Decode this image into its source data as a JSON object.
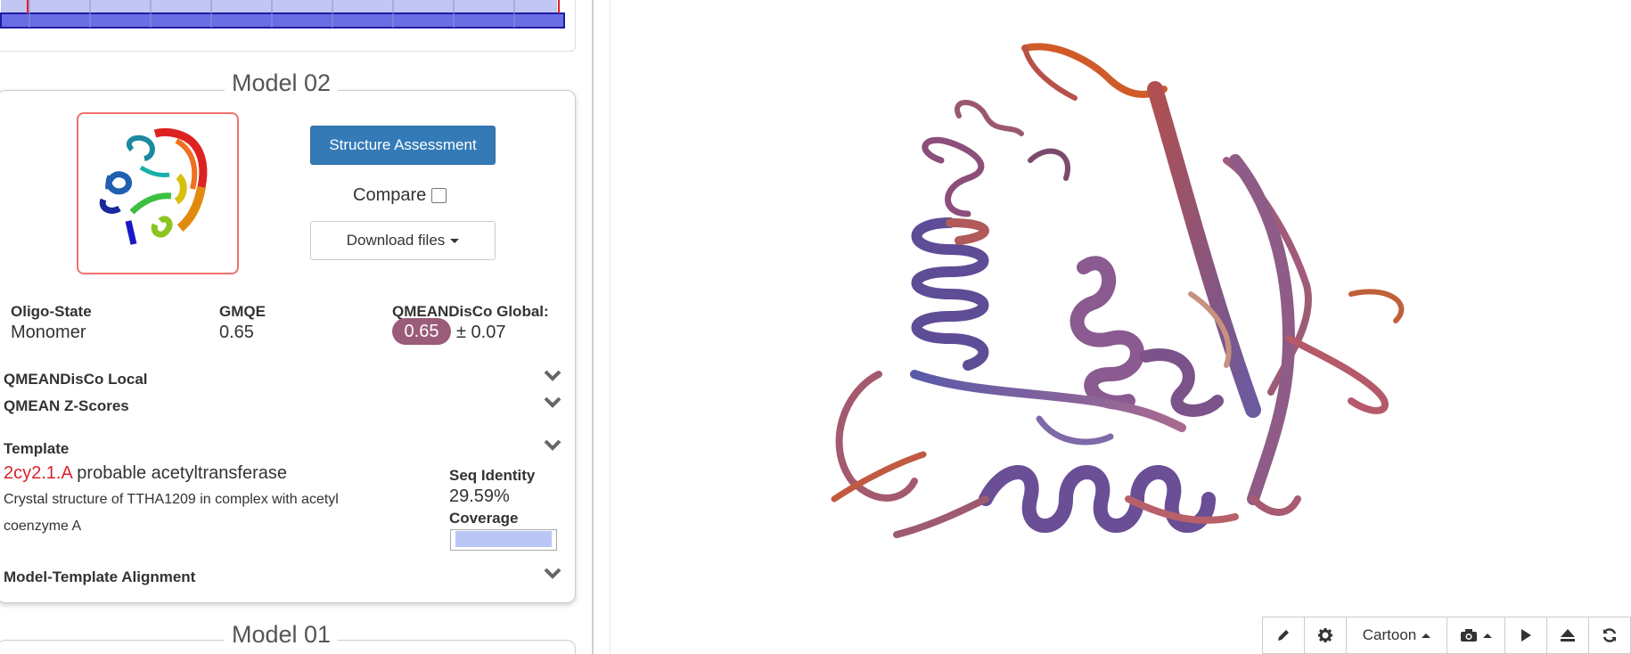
{
  "model02": {
    "legend": "Model 02",
    "buttons": {
      "assessment": "Structure Assessment",
      "compare": "Compare",
      "download": "Download files"
    },
    "stats": {
      "oligo_label": "Oligo-State",
      "oligo_value": "Monomer",
      "gmqe_label": "GMQE",
      "gmqe_value": "0.65",
      "qmean_label": "QMEANDisCo Global:",
      "qmean_value": "0.65",
      "qmean_err": "± 0.07",
      "qmean_badge_color": "#9a5c78"
    },
    "sections": {
      "local": "QMEANDisCo Local",
      "zscores": "QMEAN Z-Scores",
      "template": "Template",
      "alignment": "Model-Template Alignment"
    },
    "template": {
      "id": "2cy2.1.A",
      "name": "probable acetyltransferase",
      "description_line1": "Crystal structure of TTHA1209 in complex with acetyl",
      "description_line2": "coenzyme A",
      "seq_identity_label": "Seq Identity",
      "seq_identity_value": "29.59%",
      "coverage_label": "Coverage",
      "coverage_fraction": 0.96
    }
  },
  "model01": {
    "legend": "Model 01"
  },
  "viewer": {
    "toolbar": {
      "edit_icon": "pencil-icon",
      "settings_icon": "gear-icon",
      "representation": "Cartoon",
      "camera_icon": "camera-icon",
      "play_icon": "play-icon",
      "eject_icon": "eject-icon",
      "refresh_icon": "refresh-icon"
    }
  }
}
